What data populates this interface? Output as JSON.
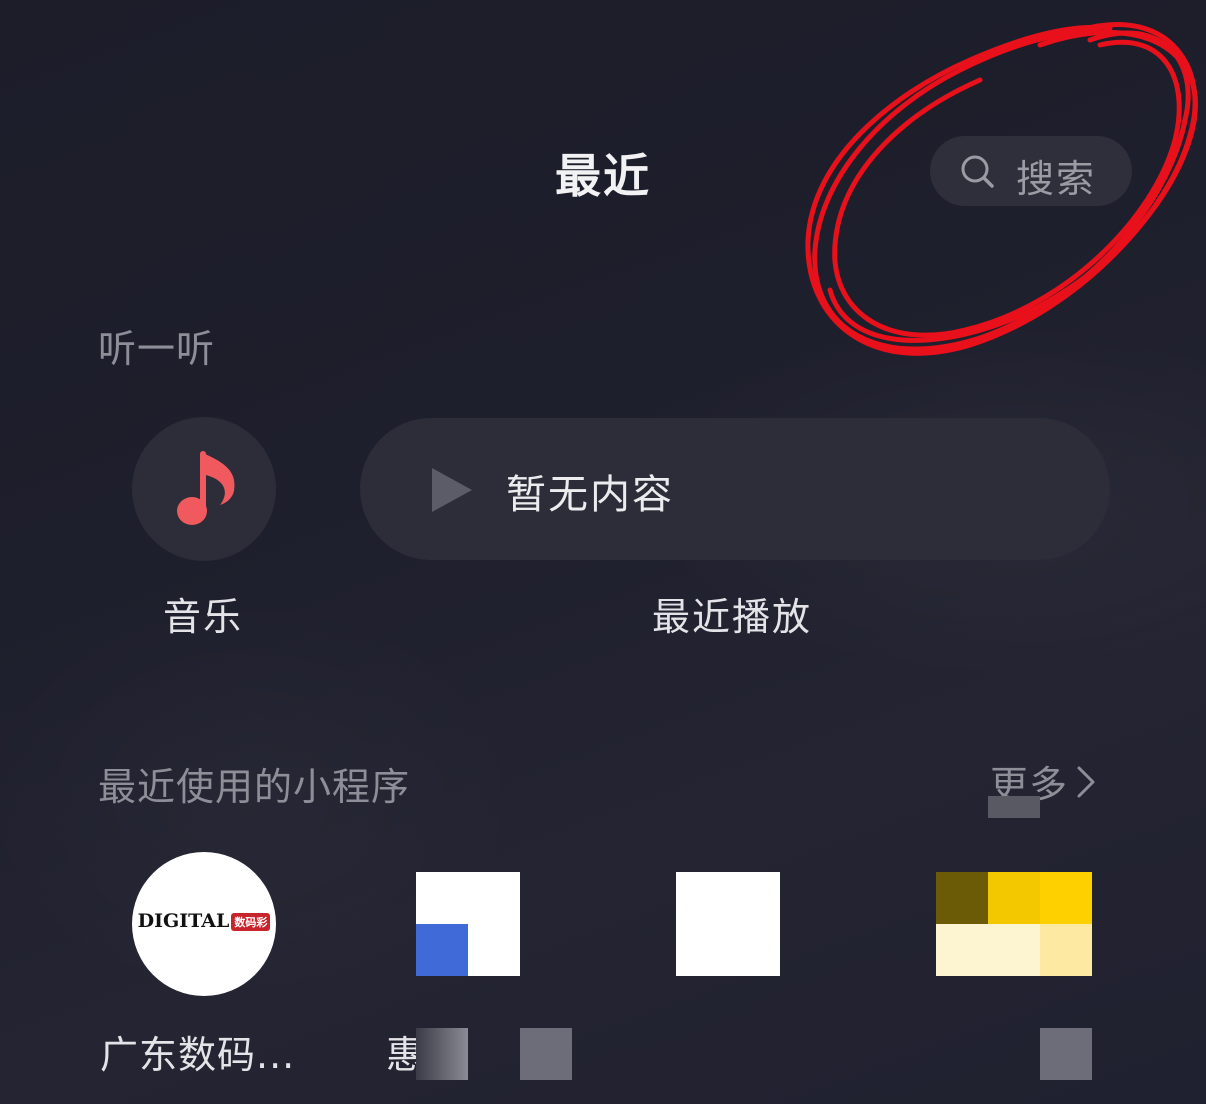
{
  "header": {
    "title": "最近",
    "search_label": "搜索"
  },
  "listen": {
    "section_label": "听一听",
    "music_label": "音乐",
    "recent_play_status": "暂无内容",
    "recent_play_label": "最近播放"
  },
  "mini_programs": {
    "section_label": "最近使用的小程序",
    "more_label": "更多",
    "items": [
      {
        "name": "广东数码...",
        "logo_text": "DIGITAL",
        "logo_tag": "数码彩"
      },
      {
        "name": "惠"
      },
      {
        "name": ""
      },
      {
        "name": ""
      }
    ]
  },
  "colors": {
    "background": "#1e1f2c",
    "pill": "#2c2d39",
    "music_accent": "#f05a5f",
    "annotation_red": "#e8101a"
  },
  "icons": {
    "search": "search-icon",
    "music": "music-note-icon",
    "play": "play-icon",
    "more": "chevron-right-icon"
  }
}
